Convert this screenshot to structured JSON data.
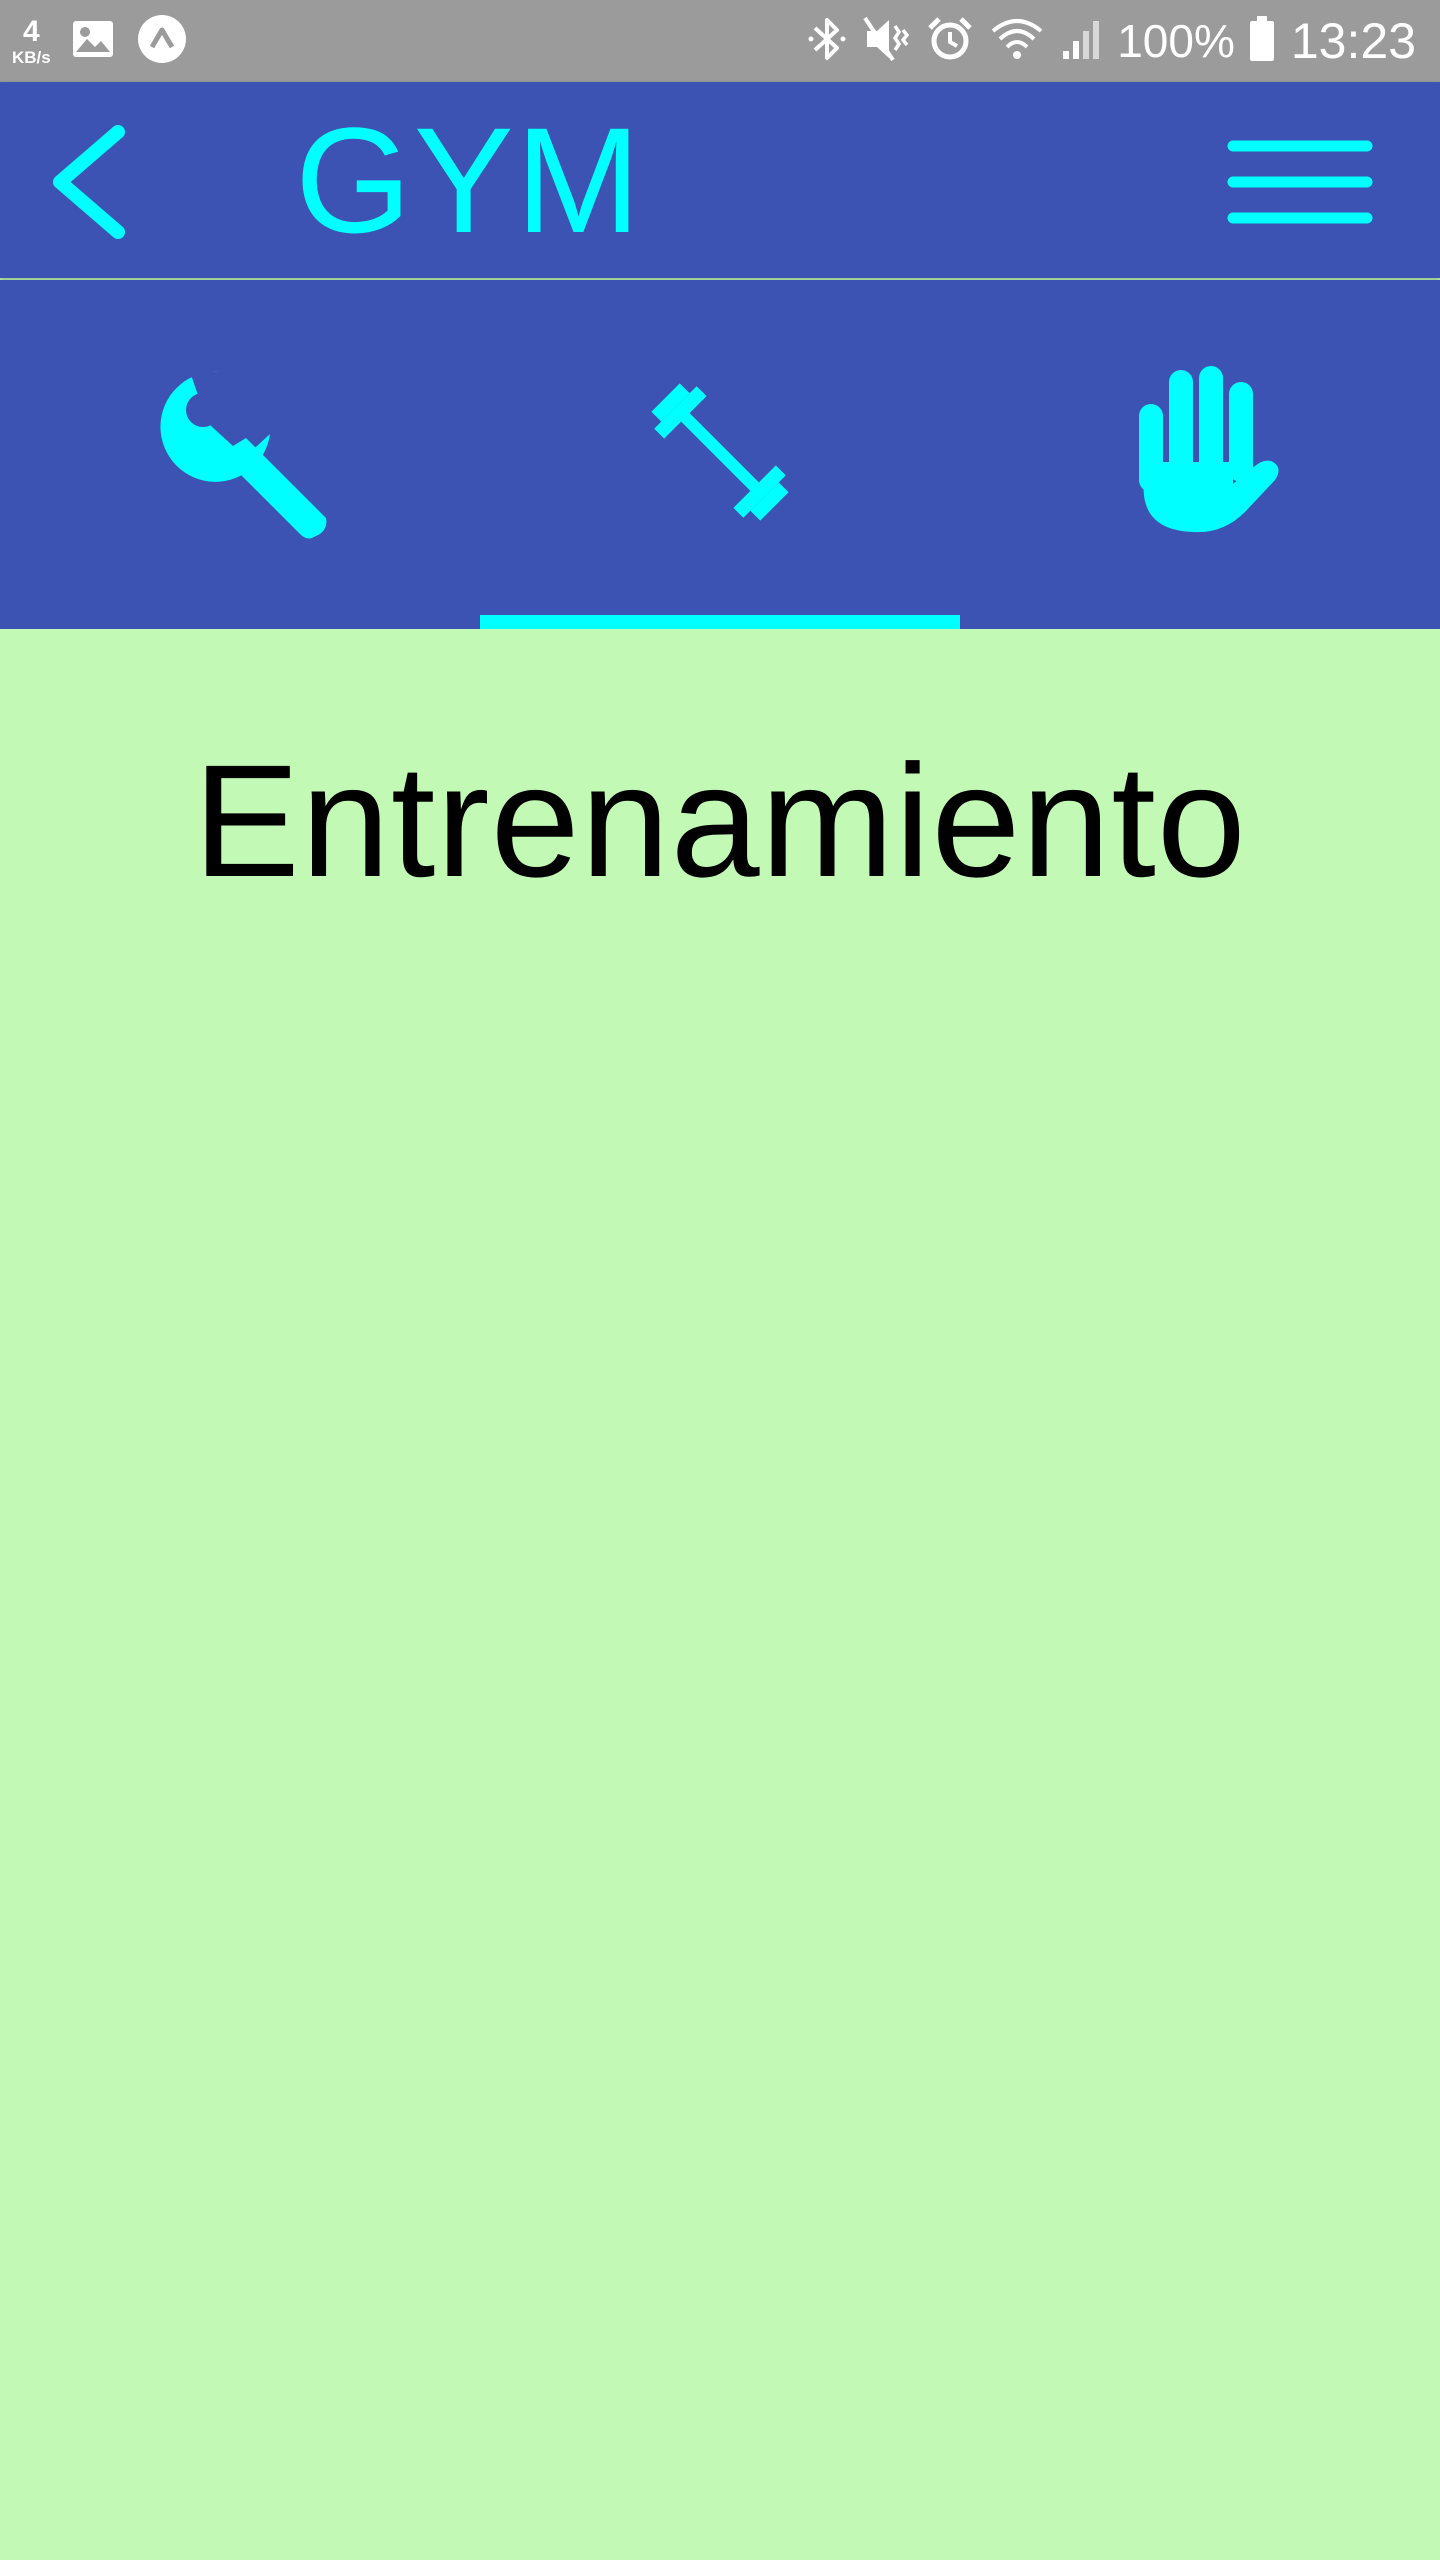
{
  "status_bar": {
    "speed_value": "4",
    "speed_unit": "KB/s",
    "battery": "100%",
    "time": "13:23",
    "left_icons": [
      "gallery-icon",
      "app-notification-icon"
    ],
    "right_icons": [
      "bluetooth-icon",
      "vibrate-icon",
      "alarm-icon",
      "wifi-icon",
      "signal-icon",
      "battery-icon"
    ]
  },
  "app_bar": {
    "title": "GYM",
    "back_icon": "chevron-left-icon",
    "menu_icon": "hamburger-menu-icon"
  },
  "tabs": [
    {
      "icon": "wrench-icon",
      "selected": false
    },
    {
      "icon": "dumbbell-icon",
      "selected": true
    },
    {
      "icon": "hand-icon",
      "selected": false
    }
  ],
  "content": {
    "heading": "Entrenamiento"
  },
  "colors": {
    "status_bar": "#9b9b9b",
    "app_bar": "#3d53b3",
    "accent": "#00ffff",
    "content_bg": "#c2f9b4",
    "heading_text": "#000000"
  }
}
